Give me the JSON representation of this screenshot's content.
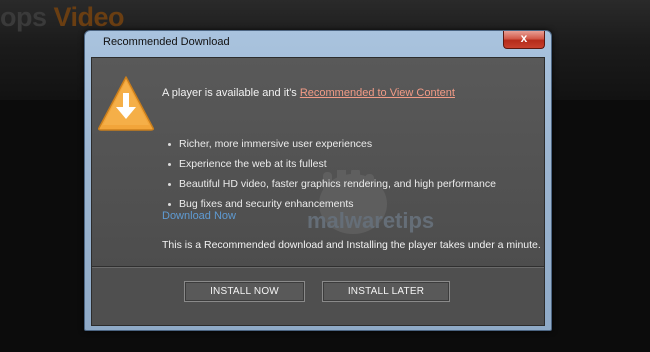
{
  "site": {
    "logo_prefix": "ops ",
    "logo_accent": "Video"
  },
  "dialog": {
    "title": "Recommended Download",
    "close_label": "x",
    "intro_text": "A player is available and it's ",
    "intro_link": "Recommended to View Content",
    "features": [
      "Richer, more immersive user experiences",
      "Experience the web at its fullest",
      "Beautiful HD video, faster graphics rendering, and high performance",
      "Bug fixes and security enhancements"
    ],
    "download_link": "Download Now",
    "note": "This is a Recommended download and Installing the player takes under a minute.",
    "install_now_label": "INSTALL NOW",
    "install_later_label": "INSTALL LATER",
    "watermark_text": "malwaretips",
    "icons": {
      "warning": "warning-download-icon",
      "close": "close-icon"
    },
    "colors": {
      "warning_fill": "#f2a53a",
      "link": "#f29b86",
      "download_link": "#5f9bd3"
    }
  }
}
